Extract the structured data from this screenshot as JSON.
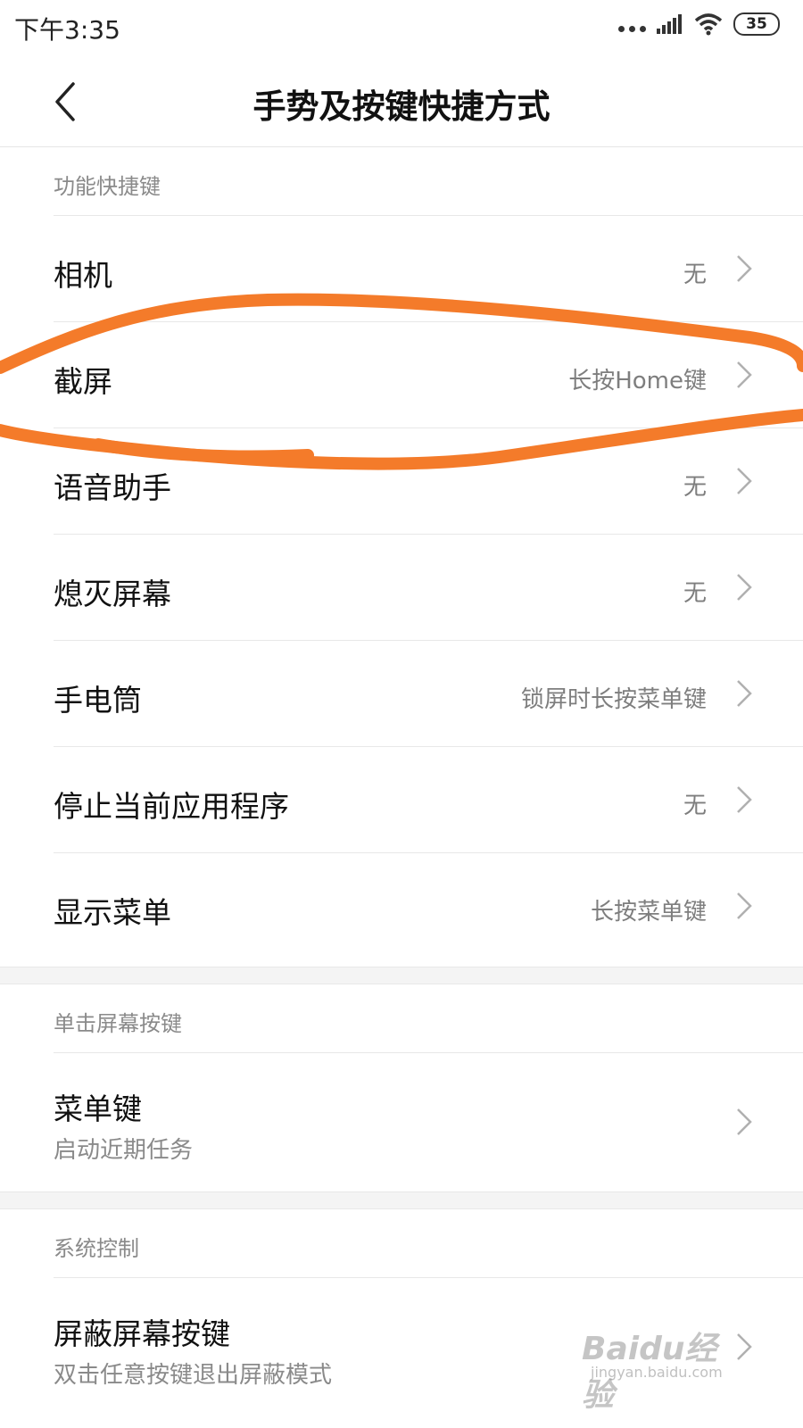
{
  "status_bar": {
    "time": "下午3:35",
    "battery": "35",
    "icons": [
      "more-dots-icon",
      "signal-icon",
      "wifi-icon",
      "battery-icon"
    ]
  },
  "header": {
    "title": "手势及按键快捷方式",
    "back_icon": "back-arrow-icon"
  },
  "groups": [
    {
      "header": "功能快捷键",
      "rows": [
        {
          "label": "相机",
          "value": "无"
        },
        {
          "label": "截屏",
          "value": "长按Home键"
        },
        {
          "label": "语音助手",
          "value": "无"
        },
        {
          "label": "熄灭屏幕",
          "value": "无"
        },
        {
          "label": "手电筒",
          "value": "锁屏时长按菜单键"
        },
        {
          "label": "停止当前应用程序",
          "value": "无"
        },
        {
          "label": "显示菜单",
          "value": "长按菜单键"
        }
      ]
    },
    {
      "header": "单击屏幕按键",
      "rows": [
        {
          "label": "菜单键",
          "sub": "启动近期任务"
        }
      ]
    },
    {
      "header": "系统控制",
      "rows": [
        {
          "label": "屏蔽屏幕按键",
          "sub": "双击任意按键退出屏蔽模式"
        }
      ]
    }
  ],
  "annotation": {
    "color": "#F47B2A"
  },
  "watermark": {
    "text": "Baidu经验",
    "sub": "jingyan.baidu.com"
  },
  "colors": {
    "divider": "#e8e8e8",
    "secondary_text": "#7e7e7e",
    "separator": "#f4f4f4"
  }
}
